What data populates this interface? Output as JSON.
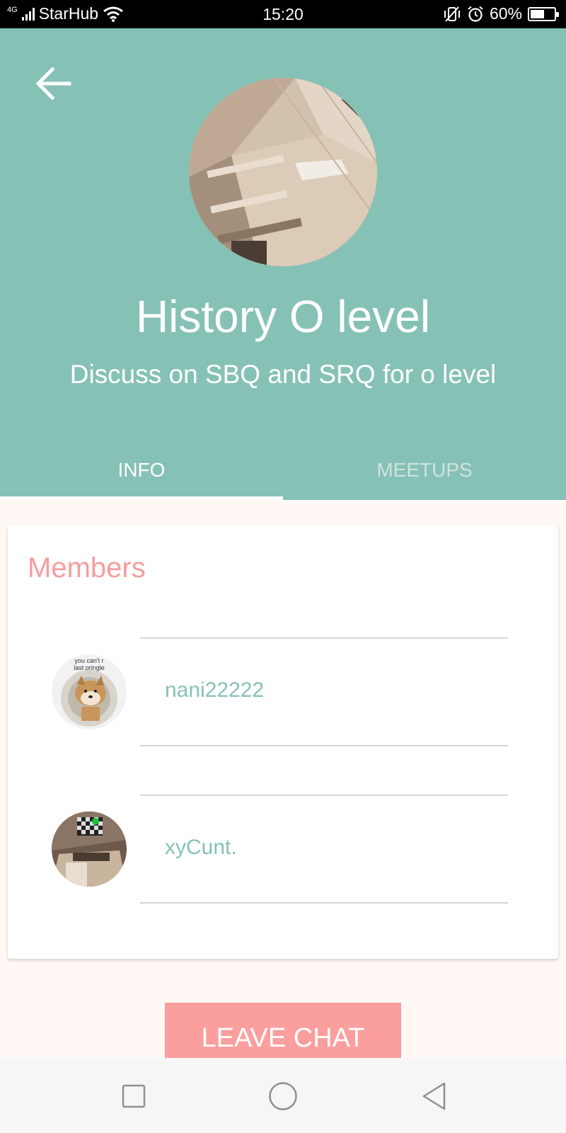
{
  "status_bar": {
    "network": "4G",
    "carrier": "StarHub",
    "time": "15:20",
    "battery_percent": "60%",
    "battery_level": 0.6
  },
  "header": {
    "back_icon": "arrow-left-icon",
    "title": "History O level",
    "description": "Discuss on SBQ and SRQ for o level",
    "background_color": "#86c1b6"
  },
  "tabs": [
    {
      "label": "INFO",
      "active": true
    },
    {
      "label": "MEETUPS",
      "active": false
    }
  ],
  "members_card": {
    "title": "Members",
    "title_color": "#f59d9e",
    "members": [
      {
        "name": "nani22222",
        "avatar_caption_1": "you can't r",
        "avatar_caption_2": "last pringle"
      },
      {
        "name": "xyCunt."
      }
    ]
  },
  "actions": {
    "leave_label": "LEAVE CHAT",
    "leave_color": "#fb9e9e"
  },
  "nav_bar": {
    "icons": [
      "recent-apps-icon",
      "home-icon",
      "back-icon"
    ]
  }
}
